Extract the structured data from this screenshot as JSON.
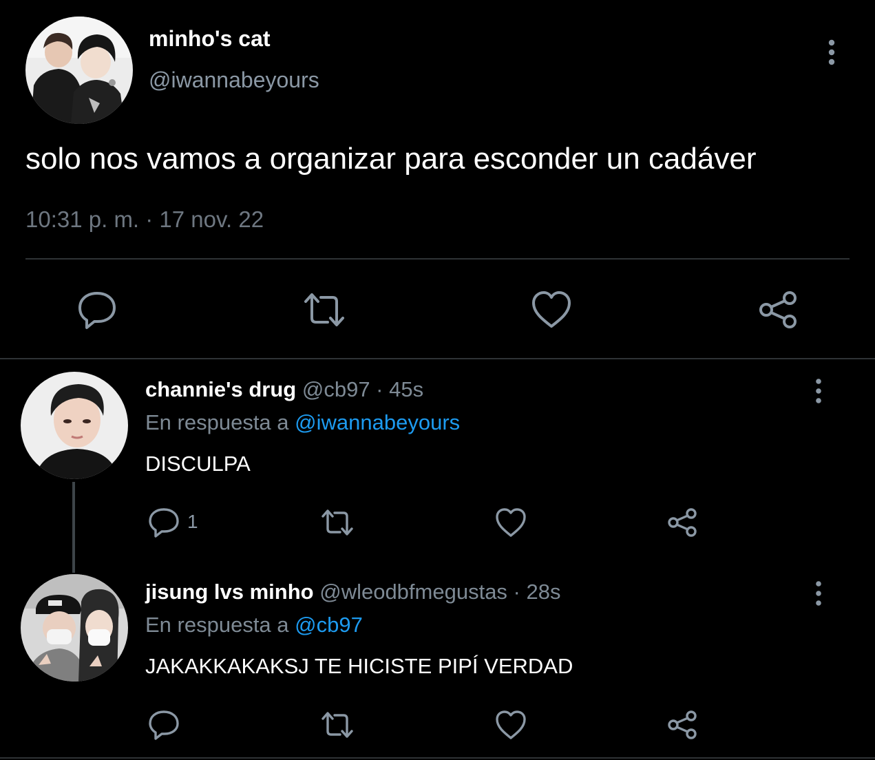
{
  "main_tweet": {
    "display_name": "minho's cat",
    "handle": "@iwannabeyours",
    "text": "solo nos vamos a organizar para esconder un cadáver",
    "timestamp": "10:31 p. m. · 17 nov. 22",
    "avatar_icon": "two-person-photo-avatar",
    "actions": [
      "reply-icon",
      "retweet-icon",
      "like-icon",
      "share-icon"
    ]
  },
  "replies": [
    {
      "display_name": "channie's drug",
      "meta": "@cb97 · 45s",
      "reply_prefix": "En respuesta a",
      "reply_to": "@iwannabeyours",
      "text": "DISCULPA",
      "reply_count": "1"
    },
    {
      "display_name": "jisung lvs minho",
      "meta": "@wleodbfmegustas · 28s",
      "reply_prefix": "En respuesta a",
      "reply_to": "@cb97",
      "text": "JAKAKKAKAKSJ TE HICISTE PIPÍ VERDAD",
      "reply_count": ""
    }
  ],
  "colors": {
    "background": "#000000",
    "primary_text": "#ffffff",
    "secondary_text": "#8b98a5",
    "link": "#1d9bf0",
    "divider": "#2f3336",
    "icon": "#8b98a5"
  }
}
